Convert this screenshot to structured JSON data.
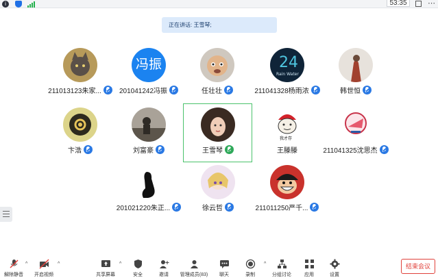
{
  "status_bar": {
    "time": "53:35"
  },
  "speaking_banner": "正在讲话: 王雪琴;",
  "participants": [
    {
      "name": "211013123朱家...",
      "mic": "blue",
      "avatar": "cat-photo"
    },
    {
      "name": "201041242冯振",
      "mic": "blue",
      "avatar_text": "冯振"
    },
    {
      "name": "任壮壮",
      "mic": "blue",
      "avatar": "child-photo"
    },
    {
      "name": "211041328杨雨浓",
      "mic": "blue",
      "avatar": "rain-water"
    },
    {
      "name": "韩世恒",
      "mic": "blue",
      "avatar": "figure-photo"
    },
    {
      "name": "卞浩",
      "mic": "blue",
      "avatar": "chinese-ring"
    },
    {
      "name": "刘富豪",
      "mic": "blue",
      "avatar": "person-dark"
    },
    {
      "name": "王雪琴",
      "mic": "green",
      "avatar": "woman-photo"
    },
    {
      "name": "王滕滕",
      "mic": "none",
      "avatar": "meme-face",
      "avatar_caption": "我才存"
    },
    {
      "name": "211041325沈思杰",
      "mic": "blue",
      "avatar": "badge-logo"
    },
    {
      "name": "201021220朱正...",
      "mic": "blue",
      "avatar": "silhouette"
    },
    {
      "name": "徐云哲",
      "mic": "blue",
      "avatar": "anime-girl"
    },
    {
      "name": "211011250严千...",
      "mic": "blue",
      "avatar": "pirate-anime"
    }
  ],
  "toolbar": {
    "unmute": "解除静音",
    "start_video": "开启视频",
    "share_screen": "共享屏幕",
    "security": "安全",
    "invite": "邀请",
    "participants": "管理成员(83)",
    "chat": "聊天",
    "record": "录制",
    "breakout": "分组讨论",
    "apps": "应用",
    "settings": "设置",
    "end_meeting": "结束会议"
  },
  "colors": {
    "mic_blue": "#2a79e4",
    "speaking_green": "#2fa95a",
    "end_red": "#e0403a",
    "banner": "#dceafb"
  }
}
